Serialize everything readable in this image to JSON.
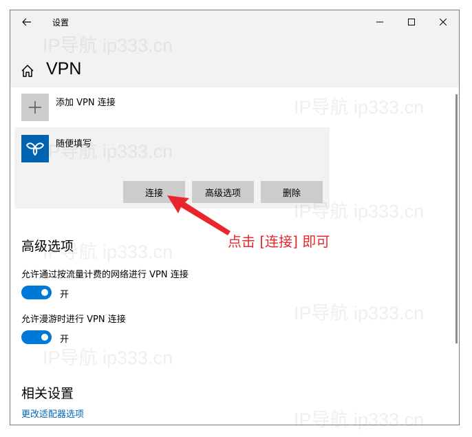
{
  "window": {
    "title": "设置",
    "back_icon": "arrow-left-icon",
    "controls": [
      "minimize",
      "maximize",
      "close"
    ]
  },
  "header": {
    "home_icon": "home-icon",
    "page_title": "VPN"
  },
  "vpn_list": {
    "add_label": "添加 VPN 连接",
    "item": {
      "name": "随便填写",
      "buttons": {
        "connect": "连接",
        "advanced": "高级选项",
        "delete": "删除"
      }
    }
  },
  "advanced": {
    "title": "高级选项",
    "settings": [
      {
        "label": "允许通过按流量计费的网络进行 VPN 连接",
        "state": "开",
        "on": true
      },
      {
        "label": "允许漫游时进行 VPN 连接",
        "state": "开",
        "on": true
      }
    ]
  },
  "related": {
    "title": "相关设置",
    "link": "更改适配器选项"
  },
  "annotation": {
    "text": "点击 [连接] 即可",
    "color": "#e8262c"
  },
  "watermark": "IP导航  ip333.cn",
  "colors": {
    "accent": "#0078d7",
    "link": "#0066b4",
    "tile_blue": "#0063b1"
  }
}
